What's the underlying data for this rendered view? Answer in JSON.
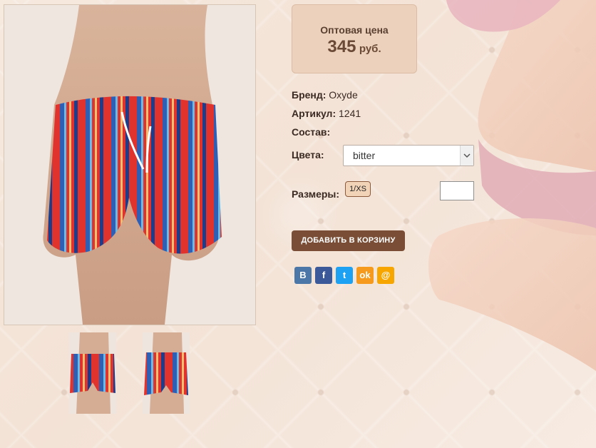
{
  "price": {
    "label": "Оптовая цена",
    "value": "345",
    "currency": "руб."
  },
  "attributes": {
    "brand_label": "Бренд:",
    "brand": "Oxyde",
    "article_label": "Артикул:",
    "article": "1241",
    "composition_label": "Состав:"
  },
  "color": {
    "label": "Цвета:",
    "selected": "bitter"
  },
  "size": {
    "label": "Размеры:",
    "option": "1/XS",
    "quantity": ""
  },
  "cart": {
    "add_label": "ДОБАВИТЬ В КОРЗИНУ"
  },
  "share": [
    {
      "icon": "vk-icon",
      "glyph": "В",
      "color": "#4a76a8"
    },
    {
      "icon": "facebook-icon",
      "glyph": "f",
      "color": "#3b5998"
    },
    {
      "icon": "twitter-icon",
      "glyph": "t",
      "color": "#1da1f2"
    },
    {
      "icon": "odnoklassniki-icon",
      "glyph": "ok",
      "color": "#f59a1d"
    },
    {
      "icon": "mailru-icon",
      "glyph": "@",
      "color": "#f7a600"
    }
  ],
  "colors": {
    "accent": "#7a4e36",
    "price_bg": "#ecd2bd"
  }
}
